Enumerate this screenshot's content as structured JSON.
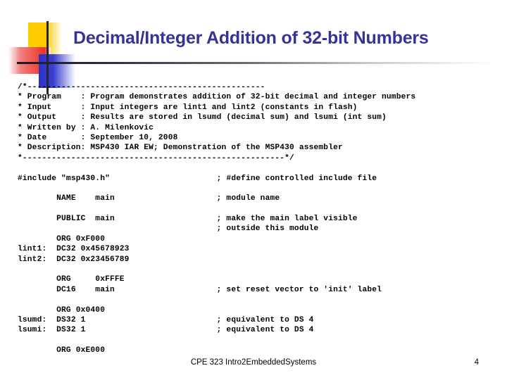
{
  "slide": {
    "title": "Decimal/Integer Addition of 32-bit Numbers",
    "title_color": "#333399"
  },
  "decoration": {
    "yellow_color": "#ffcc00",
    "red_color": "#ee3322",
    "blue_color": "#2d32c8",
    "line_color": "#242433"
  },
  "code": {
    "language": "msp430-assembly",
    "lines": [
      "/*-------------------------------------------------",
      "* Program    : Program demonstrates addition of 32-bit decimal and integer numbers",
      "* Input      : Input integers are lint1 and lint2 (constants in flash)",
      "* Output     : Results are stored in lsumd (decimal sum) and lsumi (int sum)",
      "* Written by : A. Milenkovic",
      "* Date       : September 10, 2008",
      "* Description: MSP430 IAR EW; Demonstration of the MSP430 assembler",
      "*------------------------------------------------------*/",
      "",
      "#include \"msp430.h\"                      ; #define controlled include file",
      "",
      "        NAME    main                     ; module name",
      "",
      "        PUBLIC  main                     ; make the main label visible",
      "                                         ; outside this module",
      "        ORG 0xF000",
      "lint1:  DC32 0x45678923",
      "lint2:  DC32 0x23456789",
      "",
      "        ORG     0xFFFE",
      "        DC16    main                     ; set reset vector to 'init' label",
      "",
      "        ORG 0x0400",
      "lsumd:  DS32 1                           ; equivalent to DS 4",
      "lsumi:  DS32 1                           ; equivalent to DS 4",
      "",
      "        ORG 0xE000"
    ]
  },
  "footer": {
    "course_text": "CPE 323 Intro2EmbeddedSystems",
    "page_number": "4"
  }
}
